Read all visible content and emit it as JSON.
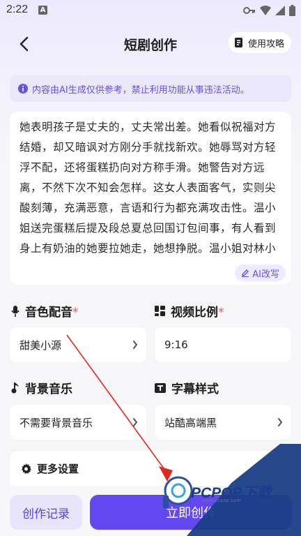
{
  "status_bar": {
    "time": "2:22",
    "notification_letter": "A"
  },
  "header": {
    "title": "短剧创作",
    "guide_label": "使用攻略"
  },
  "notice": {
    "text": "内容由AI生成仅供参考，禁止利用功能从事违法活动。"
  },
  "script": {
    "text": "她表明孩子是丈夫的，丈夫常出差。她看似祝福对方结婚，却又暗讽对方刚分手就找新欢。她辱骂对方轻浮不配，还将蛋糕扔向对方称手滑。她警告对方远离，不然下次不知会怎样。这女人表面客气，实则尖酸刻薄，充满恶意，言语和行为都充满攻击性。温小姐送完蛋糕后提及段总夏总回国订包间事，有人看到身上有奶油的她要拉她走，她想挣脱。温小姐对林小姐冷嘲热讽，说她轻浮，借手滑把蛋糕扔她身上，还警告她离远点，用言语恶毒，但林小姐并未示弱",
    "ai_rewrite_label": "AI改写"
  },
  "voice": {
    "label": "音色配音",
    "required_mark": "*",
    "value": "甜美小源"
  },
  "ratio": {
    "label": "视频比例",
    "required_mark": "*",
    "value": "9:16"
  },
  "music": {
    "label": "背景音乐",
    "value": "不需要背景音乐"
  },
  "subtitle": {
    "label": "字幕样式",
    "value": "站酷高端黑"
  },
  "more_settings": {
    "label": "更多设置"
  },
  "bottom": {
    "records_label": "创作记录",
    "create_label": "立即创作"
  },
  "watermark": {
    "text": "PCPOP下载",
    "sub": "www.pcpop.com"
  },
  "colors": {
    "accent": "#6348f0",
    "accent_light": "#e8e4fc",
    "required": "#ff4d4f"
  }
}
